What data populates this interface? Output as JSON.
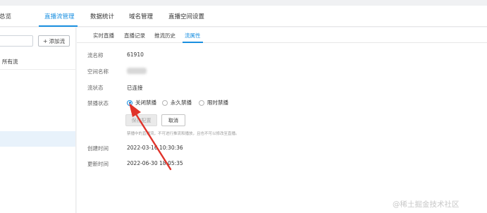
{
  "topnav": {
    "items": [
      {
        "label": "总览",
        "active": false
      },
      {
        "label": "直播流管理",
        "active": true
      },
      {
        "label": "数据统计",
        "active": false
      },
      {
        "label": "域名管理",
        "active": false
      },
      {
        "label": "直播空间设置",
        "active": false
      }
    ]
  },
  "sidebar": {
    "search": {
      "value": "",
      "placeholder": ""
    },
    "add_button": {
      "icon": "plus-icon",
      "label": "添加流"
    },
    "all_streams_label": "所有流"
  },
  "subtabs": [
    {
      "label": "实时直播",
      "active": false
    },
    {
      "label": "直播记录",
      "active": false
    },
    {
      "label": "推流历史",
      "active": false
    },
    {
      "label": "流属性",
      "active": true
    }
  ],
  "details": {
    "stream_name": {
      "label": "流名称",
      "value": "61910"
    },
    "space_name": {
      "label": "空间名称"
    },
    "stream_status": {
      "label": "流状态",
      "value": "已连接"
    },
    "ban_status": {
      "label": "禁播状态",
      "options": [
        {
          "label": "关闭禁播",
          "checked": true
        },
        {
          "label": "永久禁播",
          "checked": false
        },
        {
          "label": "限时禁播",
          "checked": false
        }
      ]
    },
    "save_button": "保存配置",
    "cancel_button": "取消",
    "hint": "禁播中的直播流，不可进行推流和播放，且也不可以修改至直播。",
    "created_time": {
      "label": "创建时间",
      "value": "2022-03-16 10:30:36"
    },
    "updated_time": {
      "label": "更新时间",
      "value": "2022-06-30 18:05:35"
    }
  },
  "colors": {
    "accent": "#1a8fe0",
    "annotation_arrow": "#e0332a"
  },
  "watermark": "@稀土掘金技术社区"
}
